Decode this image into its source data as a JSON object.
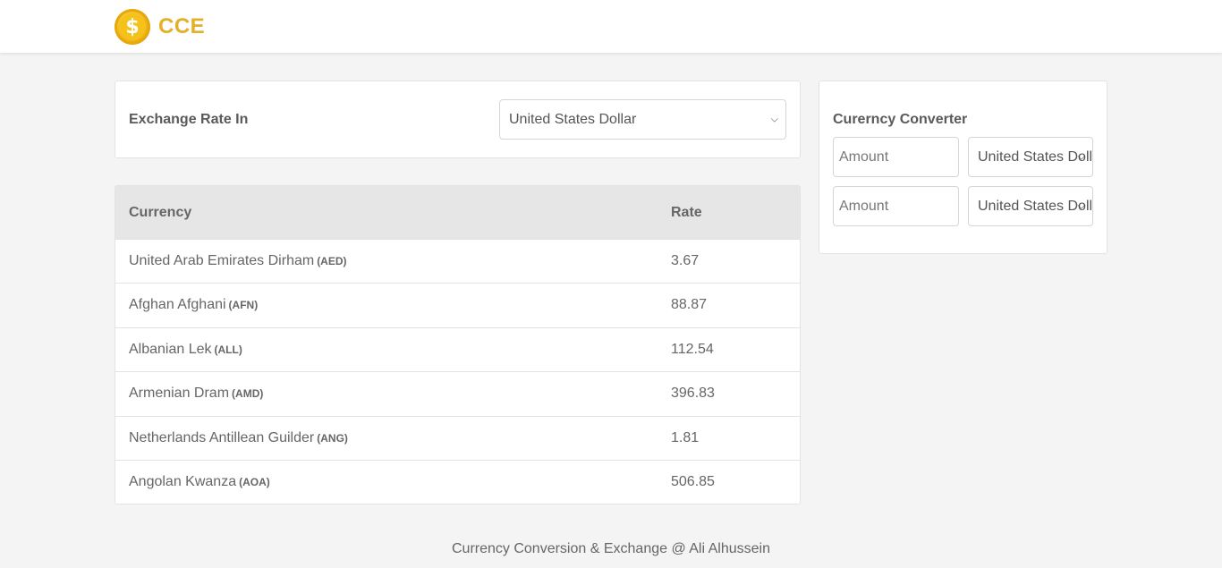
{
  "brand": {
    "logo_icon": "dollar-coin-icon",
    "name": "CCE",
    "logo_glyph": "$",
    "accent_color": "#e3b02a"
  },
  "exchange": {
    "label": "Exchange Rate In",
    "base_currency": "United States Dollar"
  },
  "table": {
    "headers": {
      "currency": "Currency",
      "rate": "Rate"
    },
    "rows": [
      {
        "name": "United Arab Emirates Dirham",
        "code": "(AED)",
        "rate": "3.67"
      },
      {
        "name": "Afghan Afghani",
        "code": "(AFN)",
        "rate": "88.87"
      },
      {
        "name": "Albanian Lek",
        "code": "(ALL)",
        "rate": "112.54"
      },
      {
        "name": "Armenian Dram",
        "code": "(AMD)",
        "rate": "396.83"
      },
      {
        "name": "Netherlands Antillean Guilder",
        "code": "(ANG)",
        "rate": "1.81"
      },
      {
        "name": "Angolan Kwanza",
        "code": "(AOA)",
        "rate": "506.85"
      }
    ]
  },
  "converter": {
    "title": "Curerncy Converter",
    "from": {
      "amount_placeholder": "Amount",
      "currency": "United States Dollar"
    },
    "to": {
      "amount_placeholder": "Amount",
      "currency": "United States Dollar"
    }
  },
  "footer": {
    "text": "Currency Conversion & Exchange @ Ali Alhussein"
  }
}
